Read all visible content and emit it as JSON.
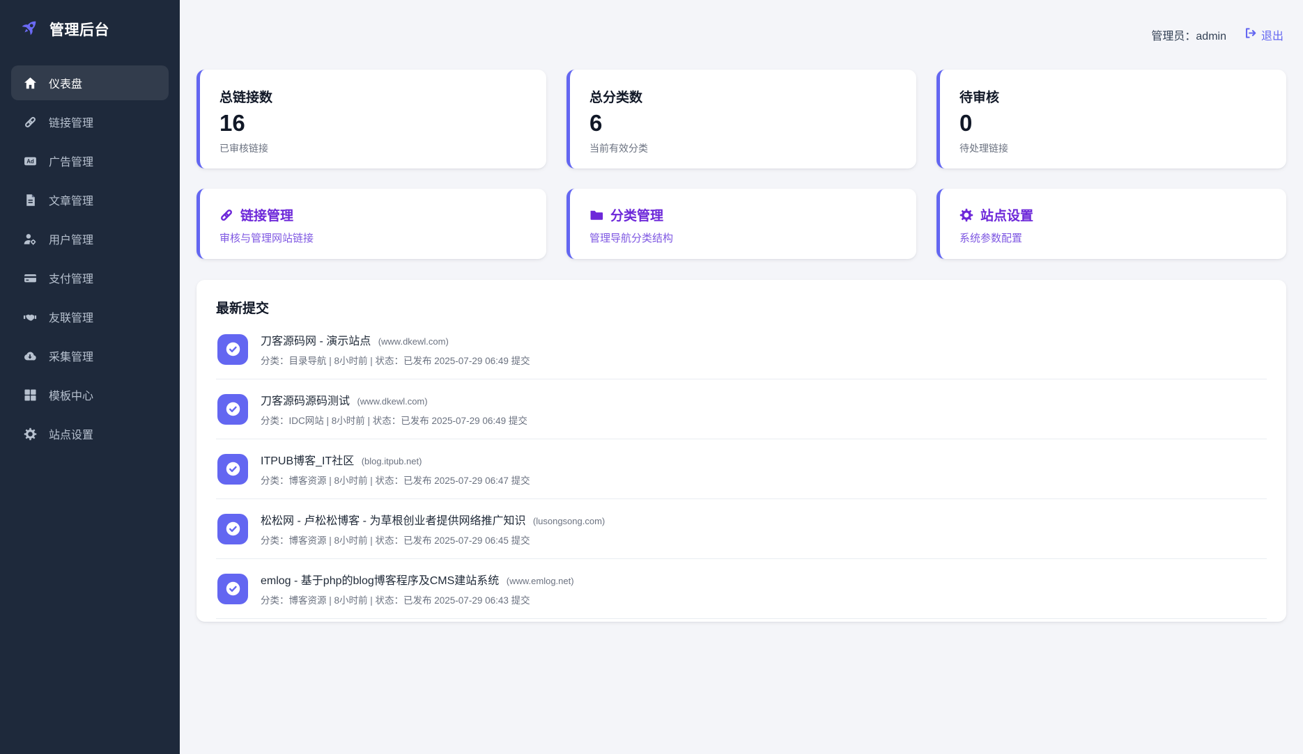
{
  "colors": {
    "accent": "#6366f1",
    "sidebar_bg": "#1e293b",
    "quick_title_purple": "#6d28d9",
    "page_bg": "#f4f5f9"
  },
  "app": {
    "title": "管理后台",
    "logo_icon": "rocket-icon"
  },
  "topbar": {
    "admin_label": "管理员：admin",
    "logout_label": "退出",
    "logout_icon": "logout-icon"
  },
  "icons": {
    "ad_glyph": "Ad"
  },
  "sidebar": {
    "items": [
      {
        "label": "仪表盘",
        "icon": "home-icon",
        "active": true
      },
      {
        "label": "链接管理",
        "icon": "link-icon",
        "active": false
      },
      {
        "label": "广告管理",
        "icon": "ad-icon",
        "active": false
      },
      {
        "label": "文章管理",
        "icon": "article-icon",
        "active": false
      },
      {
        "label": "用户管理",
        "icon": "user-cog-icon",
        "active": false
      },
      {
        "label": "支付管理",
        "icon": "credit-card-icon",
        "active": false
      },
      {
        "label": "友联管理",
        "icon": "handshake-icon",
        "active": false
      },
      {
        "label": "采集管理",
        "icon": "cloud-download-icon",
        "active": false
      },
      {
        "label": "模板中心",
        "icon": "template-grid-icon",
        "active": false
      },
      {
        "label": "站点设置",
        "icon": "gear-icon",
        "active": false
      }
    ]
  },
  "stats": [
    {
      "title": "总链接数",
      "value": "16",
      "subtitle": "已审核链接"
    },
    {
      "title": "总分类数",
      "value": "6",
      "subtitle": "当前有效分类"
    },
    {
      "title": "待审核",
      "value": "0",
      "subtitle": "待处理链接"
    }
  ],
  "quick_links": [
    {
      "title": "链接管理",
      "subtitle": "审核与管理网站链接",
      "icon": "link-icon"
    },
    {
      "title": "分类管理",
      "subtitle": "管理导航分类结构",
      "icon": "folder-icon"
    },
    {
      "title": "站点设置",
      "subtitle": "系统参数配置",
      "icon": "gear-icon"
    }
  ],
  "submissions": {
    "header": "最新提交",
    "items": [
      {
        "name": "刀客源码网 - 演示站点",
        "domain": "(www.dkewl.com)",
        "meta": "分类：目录导航 | 8小时前 | 状态：已发布 2025-07-29 06:49 提交"
      },
      {
        "name": "刀客源码源码测试",
        "domain": "(www.dkewl.com)",
        "meta": "分类：IDC网站 | 8小时前 | 状态：已发布 2025-07-29 06:49 提交"
      },
      {
        "name": "ITPUB博客_IT社区",
        "domain": "(blog.itpub.net)",
        "meta": "分类：博客资源 | 8小时前 | 状态：已发布 2025-07-29 06:47 提交"
      },
      {
        "name": "松松网 - 卢松松博客 - 为草根创业者提供网络推广知识",
        "domain": "(lusongsong.com)",
        "meta": "分类：博客资源 | 8小时前 | 状态：已发布 2025-07-29 06:45 提交"
      },
      {
        "name": "emlog - 基于php的blog博客程序及CMS建站系统",
        "domain": "(www.emlog.net)",
        "meta": "分类：博客资源 | 8小时前 | 状态：已发布 2025-07-29 06:43 提交"
      }
    ]
  }
}
